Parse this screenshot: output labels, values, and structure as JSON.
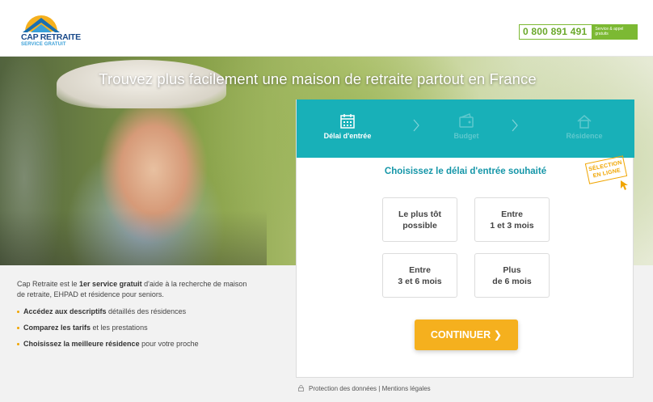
{
  "header": {
    "logo_name": "CAP RETRAITE",
    "logo_sub": "SERVICE GRATUIT",
    "phone": "0 800 891 491",
    "phone_tag": "Service & appel gratuits"
  },
  "hero": {
    "title": "Trouvez plus facilement une maison de retraite partout en France"
  },
  "info": {
    "intro_pre": "Cap Retraite est le ",
    "intro_bold": "1er service gratuit",
    "intro_post": " d'aide à la recherche de maison de retraite, EHPAD et résidence pour seniors.",
    "bullets": [
      {
        "bold": "Accédez aux descriptifs",
        "text": " détaillés des résidences"
      },
      {
        "bold": "Comparez les tarifs",
        "text": " et les prestations"
      },
      {
        "bold": "Choisissez la meilleure résidence",
        "text": " pour votre proche"
      }
    ]
  },
  "form": {
    "steps": [
      {
        "label": "Délai d'entrée",
        "icon": "calendar-icon",
        "active": true
      },
      {
        "label": "Budget",
        "icon": "wallet-icon",
        "active": false
      },
      {
        "label": "Résidence",
        "icon": "home-icon",
        "active": false
      }
    ],
    "title": "Choisissez le délai d'entrée souhaité",
    "stamp_line1": "SÉLECTION",
    "stamp_line2": "EN LIGNE",
    "options": [
      {
        "line1": "Le plus tôt",
        "line2": "possible"
      },
      {
        "line1": "Entre",
        "line2": "1 et 3 mois"
      },
      {
        "line1": "Entre",
        "line2": "3 et 6 mois"
      },
      {
        "line1": "Plus",
        "line2": "de 6 mois"
      }
    ],
    "cta": "CONTINUER ❯"
  },
  "footer": {
    "privacy": "Protection des données",
    "separator": "|",
    "legal": "Mentions légales"
  },
  "colors": {
    "teal": "#18b0b8",
    "orange": "#f5b01e",
    "green": "#7cb933",
    "navy": "#1a4a8a"
  }
}
